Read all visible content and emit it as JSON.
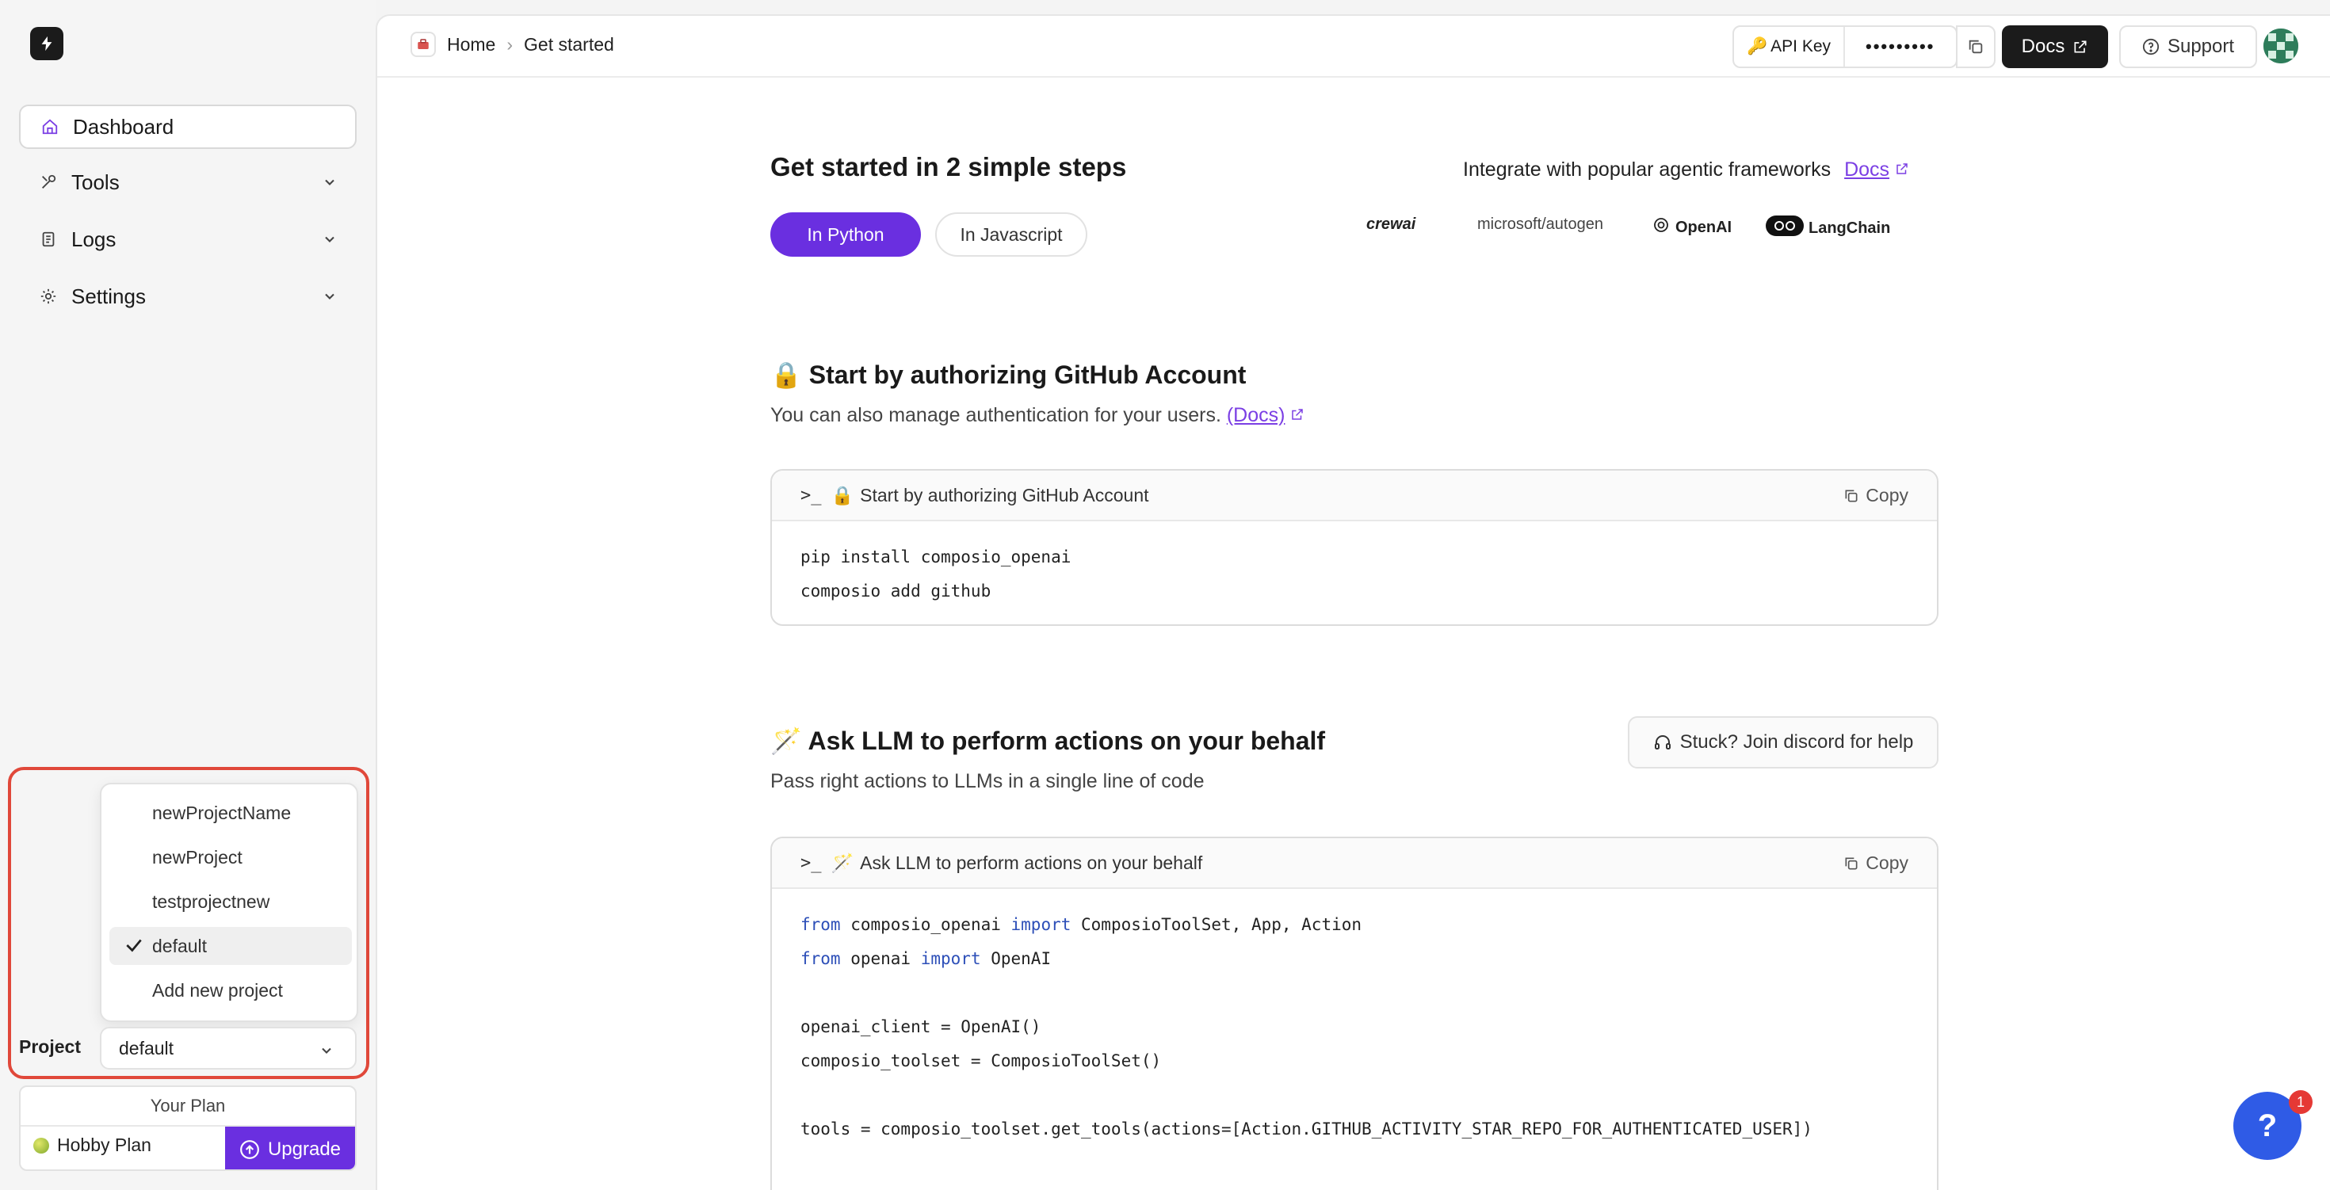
{
  "sidebar": {
    "items": [
      {
        "label": "Dashboard"
      },
      {
        "label": "Tools"
      },
      {
        "label": "Logs"
      },
      {
        "label": "Settings"
      }
    ],
    "project_dropdown": {
      "options": [
        "newProjectName",
        "newProject",
        "testprojectnew",
        "default",
        "Add new project"
      ],
      "selected": "default"
    },
    "project_label": "Project",
    "project_value": "default",
    "plan": {
      "title": "Your Plan",
      "name": "Hobby Plan",
      "upgrade_label": "Upgrade"
    }
  },
  "header": {
    "breadcrumb": [
      "Home",
      "Get started"
    ],
    "api_key_label": "API Key",
    "api_key_value": "•••••••••",
    "docs_label": "Docs",
    "support_label": "Support"
  },
  "main": {
    "title": "Get started in 2 simple steps",
    "tabs": [
      "In Python",
      "In Javascript"
    ],
    "integrate_text": "Integrate with popular agentic frameworks",
    "integrate_link": "Docs",
    "frameworks": [
      "crewai",
      "microsoft/autogen",
      "OpenAI",
      "LangChain"
    ],
    "step1": {
      "title": "Start by authorizing GitHub Account",
      "subtitle": "You can also manage authentication for your users.",
      "docs_link": "(Docs)",
      "code_title": "Start by authorizing GitHub Account",
      "copy_label": "Copy",
      "code": [
        "pip install composio_openai",
        "composio add github"
      ]
    },
    "step2": {
      "title": "Ask LLM to perform actions on your behalf",
      "subtitle": "Pass right actions to LLMs in a single line of code",
      "discord_label": "Stuck? Join discord for help",
      "code_title": "Ask LLM to perform actions on your behalf",
      "copy_label": "Copy",
      "code": [
        "from composio_openai import ComposioToolSet, App, Action",
        "from openai import OpenAI",
        "",
        "openai_client = OpenAI()",
        "composio_toolset = ComposioToolSet()",
        "",
        "tools = composio_toolset.get_tools(actions=[Action.GITHUB_ACTIVITY_STAR_REPO_FOR_AUTHENTICATED_USER])"
      ]
    }
  },
  "help_badge": "1",
  "help_label": "?",
  "colors": {
    "accent": "#6a2fe0",
    "highlight": "#e0483a",
    "help": "#2f5be6"
  }
}
